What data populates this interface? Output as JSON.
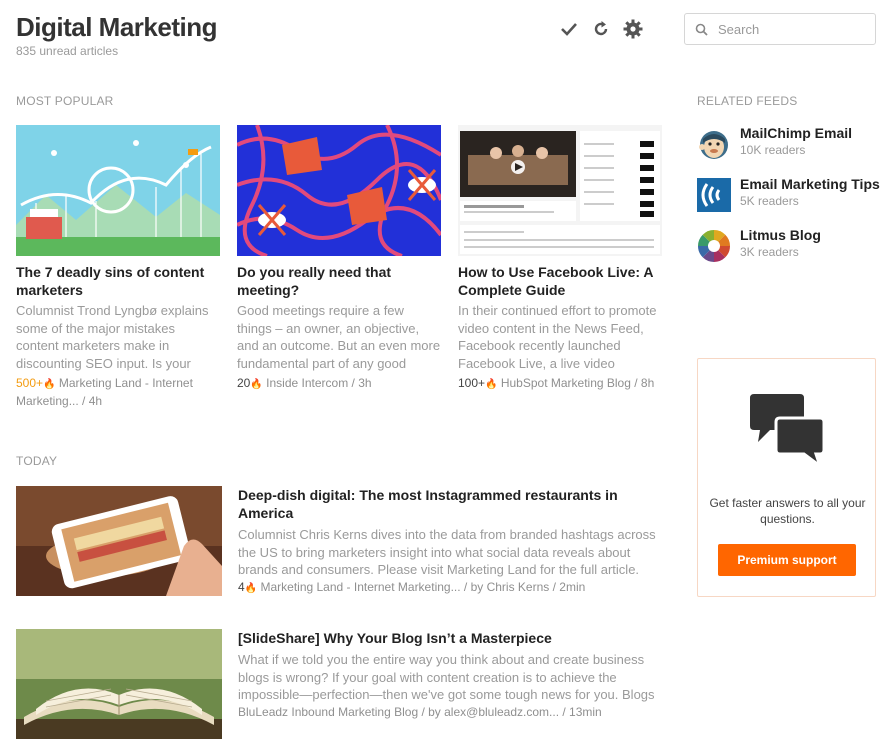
{
  "header": {
    "title": "Digital Marketing",
    "subtitle": "835 unread articles",
    "actions": [
      {
        "icon": "checkmark-icon",
        "label": "Mark as read"
      },
      {
        "icon": "refresh-icon",
        "label": "Refresh"
      },
      {
        "icon": "gear-icon",
        "label": "Settings"
      }
    ]
  },
  "search": {
    "placeholder": "Search",
    "value": ""
  },
  "most_popular": {
    "label": "MOST POPULAR",
    "articles": [
      {
        "title": "The 7 deadly sins of content marketers",
        "summary": "Columnist Trond Lyngbø explains some of the major mistakes content marketers make in discounting SEO input. Is your",
        "engagement": "500+",
        "source_line": "Marketing Land - Internet Marketing... / 4h"
      },
      {
        "title": "Do you really need that meeting?",
        "summary": "Good meetings require a few things – an owner, an objective, and an outcome. But an even more fundamental part of any good",
        "engagement": "20",
        "source_line": "Inside Intercom / 3h"
      },
      {
        "title": "How to Use Facebook Live: A Complete Guide",
        "summary": "In their continued effort to promote video content in the News Feed, Facebook recently launched Facebook Live, a live video",
        "engagement": "100+",
        "source_line": "HubSpot Marketing Blog / 8h"
      }
    ]
  },
  "today": {
    "label": "TODAY",
    "articles": [
      {
        "title": "Deep-dish digital: The most Instagrammed restaurants in America",
        "summary": "Columnist Chris Kerns dives into the data from branded hashtags across the US to bring marketers insight into what social data reveals about brands and consumers. Please visit Marketing Land for the full article.",
        "engagement": "4",
        "source_line": "Marketing Land - Internet Marketing... / by Chris Kerns / 2min"
      },
      {
        "title": "[SlideShare] Why Your Blog Isn’t a Masterpiece",
        "summary": "What if we told you the entire way you think about and create business blogs is wrong? If your goal with content creation is to achieve the impossible—perfection—then we've got some tough news for you.  Blogs",
        "engagement": "",
        "source_line": "BluLeadz Inbound Marketing Blog / by alex@bluleadz.com... / 13min"
      }
    ]
  },
  "related_feeds": {
    "label": "RELATED FEEDS",
    "feeds": [
      {
        "name": "MailChimp Email",
        "readers": "10K readers",
        "icon": "mailchimp-logo-icon"
      },
      {
        "name": "Email Marketing Tips",
        "readers": "5K readers",
        "icon": "wave-logo-icon"
      },
      {
        "name": "Litmus Blog",
        "readers": "3K readers",
        "icon": "litmus-logo-icon"
      }
    ]
  },
  "promo": {
    "icon": "chat-bubbles-icon",
    "text": "Get faster answers to all your questions.",
    "button_label": "Premium support"
  },
  "colors": {
    "accent": "#ff6600",
    "hot_engagement": "#f39c12",
    "muted_text": "#9a9a9a"
  }
}
